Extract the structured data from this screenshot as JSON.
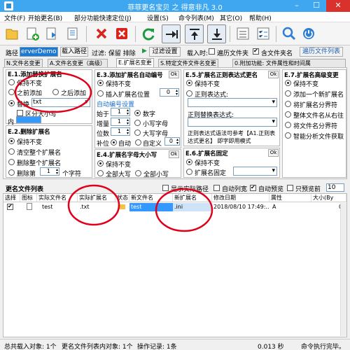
{
  "window": {
    "title": "菲菲更名宝贝 之 得意非凡 3.0",
    "minimize": "–",
    "maximize": "☐",
    "close": "✕"
  },
  "menu": [
    "文件(F)",
    "开始更名(B)",
    "部分功能快速定位(J)",
    "设置(S)",
    "命令列表(M)",
    "其它(O)",
    "帮助(H)"
  ],
  "toolbar": {
    "icons": [
      "open-file-icon",
      "add-file-icon",
      "import-icon",
      "list-icon",
      "delete-icon",
      "remove-all-icon",
      "refresh-icon",
      "arrow-right-icon",
      "arrow-up-icon",
      "arrow-down-icon",
      "task-list-icon",
      "checklist-icon",
      "search-icon",
      "exit-icon"
    ]
  },
  "pathbar": {
    "path_label": "路径",
    "path_value": "erverDemo",
    "load_path": "载入路径",
    "filter_label": "过滤: 保留 排除",
    "filter_settings": "过滤设置",
    "load_when": "载入时:",
    "traverse_label": "遍历文件夹",
    "include_folder_label": "含文件夹名",
    "traverse_checked": false,
    "include_folder_checked": true,
    "traverse_list": "遍历文件列表"
  },
  "tabs": [
    "N.文件名变更",
    "A.文件名变更（高级）",
    "E.扩展名变更",
    "S.特定文件文件名变更",
    "0.附加功能: 文件属性和时间属"
  ],
  "active_tab": 2,
  "e1": {
    "title": "E.1.添加替换扩展名",
    "keep": "保持不变",
    "prefix": "之前添加",
    "suffix": "之后添加",
    "replace": "替换",
    "replace_value": "txt",
    "case_sensitive": "区分大小写",
    "content_label": "内"
  },
  "e2": {
    "title": "E.2.删除扩展名",
    "keep": "保持不变",
    "clear_all": "清空整个扩展名",
    "delete_all": "删除整个扩展名",
    "delete_part": "删除第",
    "num": "1",
    "unit": "个字符"
  },
  "e3": {
    "title": "E.3.添加扩展名自动编号",
    "ok": "Ok",
    "keep": "保持不变",
    "insert_pos": "插入扩展名位置",
    "insert_num": "0",
    "autonum_title": "自动编号设置",
    "start_label": "始于",
    "start_val": "1",
    "step_label": "增量",
    "step_val": "1",
    "digits_label": "位数",
    "digits_val": "1",
    "digit": "数字",
    "lower": "小写字母",
    "upper": "大写字母",
    "pad_label": "补位",
    "auto": "自动",
    "custom": "自定义",
    "custom_val": "0"
  },
  "e4": {
    "title": "E.4.扩展名字母大小写",
    "ok": "Ok",
    "keep": "保持不变",
    "all_upper": "全部大写",
    "all_lower": "全部小写"
  },
  "e5": {
    "title": "E.5.扩展名正则表达式更名",
    "ok": "Ok",
    "keep": "保持不变",
    "regex": "正则表达式:",
    "replace_label": "正则替换表达式:",
    "note": "正则表达式语法可参考【A1.正则表达式更名】 即字即用模式"
  },
  "e6": {
    "title": "E.6.扩展名固定",
    "ok": "Ok",
    "keep": "保持不变",
    "fixed": "扩展名固定"
  },
  "e7": {
    "title": "E.7.扩展名高级变更",
    "keep": "保持不变",
    "items": [
      "添加一个新扩展名",
      "将扩展名分界符",
      "整体文件名从右往",
      "将文件名分界符",
      "智能分析文件获取"
    ]
  },
  "list": {
    "title": "更名文件列表",
    "show_real_path": "显示实际路径",
    "auto_list": "自动列宽",
    "auto_preview": "自动预览",
    "show_first": "只预览前",
    "show_first_val": "10",
    "show_real_path_checked": false,
    "auto_list_checked": false,
    "auto_preview_checked": true,
    "show_first_checked": false,
    "columns": [
      "选择",
      "图标",
      "实际文件名",
      "实际扩展名",
      "状态",
      "新文件名",
      "新扩展名",
      "修改日期",
      "属性",
      "大小(By"
    ],
    "rows": [
      {
        "checked": true,
        "name": "test",
        "ext": ".txt",
        "new_name": "test",
        "new_ext": ".ini",
        "modified": "2018/08/10 17:49:...",
        "attr": "A",
        "size": "0"
      }
    ]
  },
  "status": {
    "loaded": "总共载入对象: 1个",
    "in_list": "更名文件列表内对象: 1个",
    "log": "操作记录: 1条",
    "size": "0.013 秒",
    "done": "命令执行完毕。"
  },
  "colors": {
    "titlebar": "#3fa7f0",
    "close": "#d9312c",
    "annotation": "#e0001a",
    "selection": "#3399ff"
  }
}
